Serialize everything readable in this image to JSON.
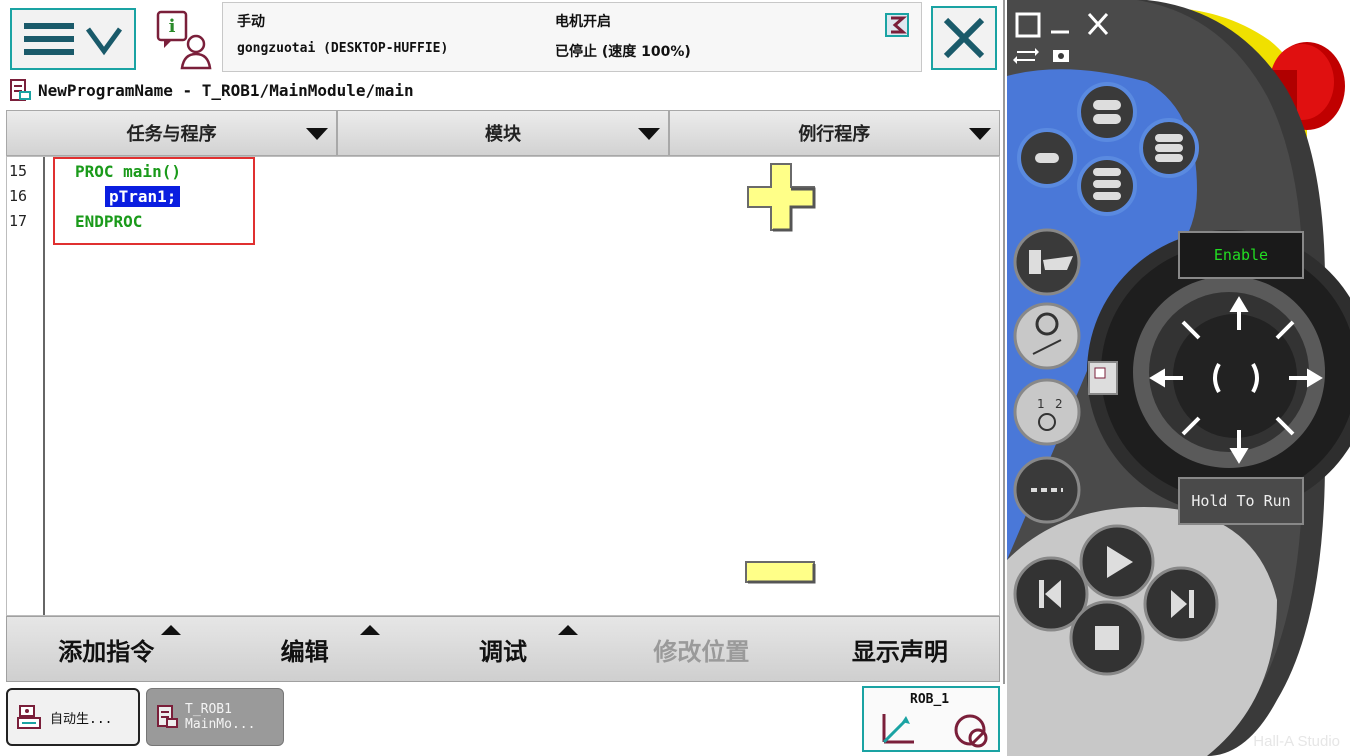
{
  "status": {
    "mode": "手动",
    "controller": "gongzuotai (DESKTOP-HUFFIE)",
    "motor": "电机开启",
    "run_state": "已停止 (速度 100%)"
  },
  "breadcrumb": "NewProgramName - T_ROB1/MainModule/main",
  "tabs": [
    {
      "label": "任务与程序"
    },
    {
      "label": "模块"
    },
    {
      "label": "例行程序"
    }
  ],
  "editor": {
    "line_numbers": [
      "15",
      "16",
      "17"
    ],
    "lines": [
      "PROC main()",
      "pTran1;",
      "ENDPROC"
    ]
  },
  "commands": [
    {
      "label": "添加指令",
      "enabled": true
    },
    {
      "label": "编辑",
      "enabled": true
    },
    {
      "label": "调试",
      "enabled": true
    },
    {
      "label": "修改位置",
      "enabled": false
    },
    {
      "label": "显示声明",
      "enabled": true
    }
  ],
  "taskbar": {
    "auto_task": "自动生...",
    "rob_task_line1": "T_ROB1",
    "rob_task_line2": "MainMo...",
    "rob_indicator": "ROB_1"
  },
  "jog_panel": {
    "enable_label": "Enable",
    "hold_label": "Hold To Run"
  },
  "watermark": "Hall-A Studio",
  "colors": {
    "accent": "#1aa3a3",
    "code_green": "#1a9a1a",
    "selection": "#0a1ee0",
    "highlight_box": "#e03030",
    "zoom_yellow": "#ffff88",
    "jog_blue": "#4a78d8",
    "emergency_red": "#e01010",
    "hold_yellow": "#f0e000"
  }
}
